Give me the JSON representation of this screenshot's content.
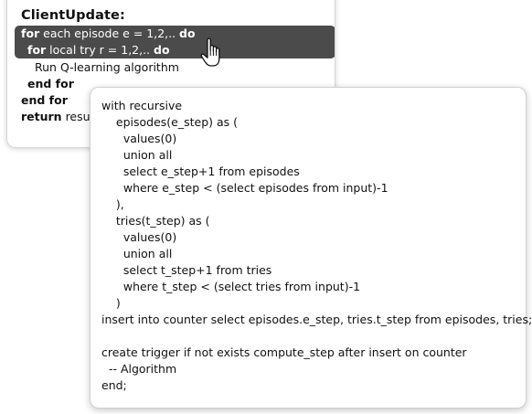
{
  "algorithm": {
    "title": "ClientUpdate:",
    "lines": [
      {
        "kw": "for",
        "text": " each episode e = 1,2,.. ",
        "kw2": "do"
      },
      {
        "kw": "for",
        "text": " local try r = 1,2,.. ",
        "kw2": "do"
      },
      {
        "kw": "",
        "text": "Run Q-learning algorithm",
        "kw2": ""
      },
      {
        "kw": "end for",
        "text": "",
        "kw2": ""
      },
      {
        "kw": "end for",
        "text": "",
        "kw2": ""
      },
      {
        "kw": "return",
        "text": " resul",
        "kw2": ""
      }
    ]
  },
  "sql": {
    "lines": [
      "with recursive",
      "    episodes(e_step) as (",
      "      values(0)",
      "      union all",
      "      select e_step+1 from episodes",
      "      where e_step < (select episodes from input)-1",
      "    ),",
      "    tries(t_step) as (",
      "      values(0)",
      "      union all",
      "      select t_step+1 from tries",
      "      where t_step < (select tries from input)-1",
      "    )",
      "insert into counter select episodes.e_step, tries.t_step from episodes, tries;",
      "",
      "create trigger if not exists compute_step after insert on counter",
      "  -- Algorithm",
      "end;"
    ]
  },
  "cursor": {
    "icon": "hand-pointer-icon"
  }
}
